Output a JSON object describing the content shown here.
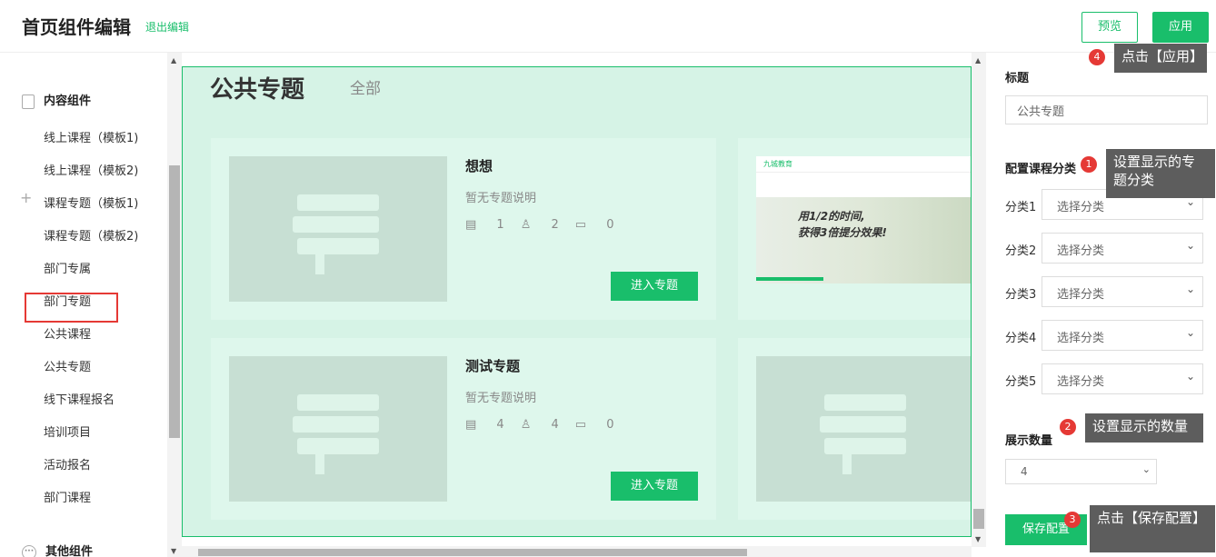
{
  "header": {
    "title": "首页组件编辑",
    "exit": "退出编辑",
    "preview": "预览",
    "apply": "应用"
  },
  "sidebar": {
    "group1": "内容组件",
    "items": [
      "线上课程（模板1)",
      "线上课程（模板2)",
      "课程专题（模板1)",
      "课程专题（模板2)",
      "部门专属",
      "部门专题",
      "公共课程",
      "公共专题",
      "线下课程报名",
      "培训项目",
      "活动报名",
      "部门课程"
    ],
    "group2": "其他组件"
  },
  "canvas": {
    "title": "公共专题",
    "all": "全部",
    "cards": [
      {
        "title": "想想",
        "desc": "暂无专题说明",
        "docs": "1",
        "users": "2",
        "comments": "0",
        "btn": "进入专题"
      },
      {
        "title": "测试专题",
        "desc": "暂无专题说明",
        "docs": "4",
        "users": "4",
        "comments": "0",
        "btn": "进入专题"
      }
    ],
    "banner": {
      "logo": "九城教育",
      "headline1": "用1/2的时间,",
      "headline2": "获得3倍提分效果!"
    }
  },
  "panel": {
    "title_label": "标题",
    "title_value": "公共专题",
    "config_label": "配置课程分类",
    "categories": [
      {
        "label": "分类1",
        "value": "选择分类"
      },
      {
        "label": "分类2",
        "value": "选择分类"
      },
      {
        "label": "分类3",
        "value": "选择分类"
      },
      {
        "label": "分类4",
        "value": "选择分类"
      },
      {
        "label": "分类5",
        "value": "选择分类"
      }
    ],
    "count_label": "展示数量",
    "count_value": "4",
    "save": "保存配置"
  },
  "tips": {
    "t1": "设置显示的专题分类",
    "n1": "1",
    "t2": "设置显示的数量",
    "n2": "2",
    "t3": "点击【保存配置】",
    "n3": "3",
    "t4": "点击【应用】",
    "n4": "4"
  },
  "colors": {
    "accent": "#19be6b",
    "highlight": "#e53935",
    "tip": "#5d5d5d"
  }
}
